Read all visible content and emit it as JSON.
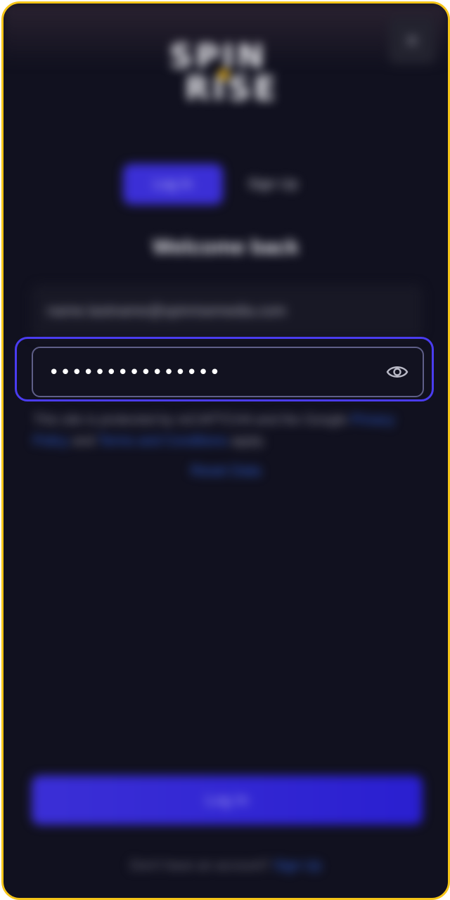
{
  "header": {
    "close_glyph": "×",
    "logo_line1": "SPIN",
    "logo_line2": "RISE"
  },
  "tabs": [
    {
      "label": "Log In",
      "active": true
    },
    {
      "label": "Sign Up",
      "active": false
    }
  ],
  "welcome": "Welcome back",
  "email": {
    "value": "name.lastname@spinrisemedia.com"
  },
  "password": {
    "value": "•••••••••••••••",
    "toggle_icon": "eye-icon"
  },
  "legal": {
    "text": "This site is protected by reCAPTCHA and the Google ",
    "privacy_link": "Privacy Policy",
    "and": " and ",
    "terms_link": "Terms and Conditions",
    "tail": " apply."
  },
  "reset_link": "Reset Data",
  "login_button": "Log In",
  "footer": {
    "text": "Don't have an account? ",
    "link": "Sign Up"
  },
  "colors": {
    "frame_border": "#f5c518",
    "background": "#11111f",
    "accent": "#3b2fd6",
    "highlight": "#4a3cf0",
    "link": "#2f5fd8"
  }
}
